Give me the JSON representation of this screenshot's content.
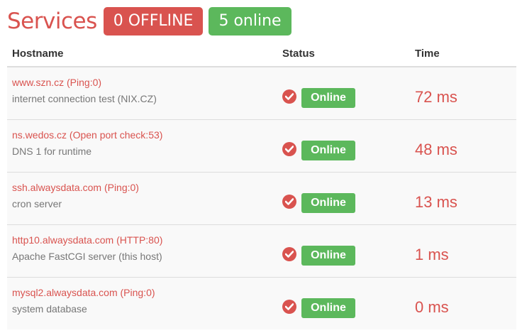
{
  "header": {
    "title": "Services",
    "offline_badge": "0 OFFLINE",
    "online_badge": "5 online"
  },
  "columns": {
    "hostname": "Hostname",
    "status": "Status",
    "time": "Time"
  },
  "colors": {
    "accent_red": "#d9534f",
    "success_green": "#5cb85c"
  },
  "rows": [
    {
      "host": "www.szn.cz (Ping:0)",
      "desc": "internet connection test (NIX.CZ)",
      "status": "Online",
      "time": "72 ms",
      "status_icon": "check-circle-icon"
    },
    {
      "host": "ns.wedos.cz (Open port check:53)",
      "desc": "DNS 1 for runtime",
      "status": "Online",
      "time": "48 ms",
      "status_icon": "check-circle-icon"
    },
    {
      "host": "ssh.alwaysdata.com (Ping:0)",
      "desc": "cron server",
      "status": "Online",
      "time": "13 ms",
      "status_icon": "check-circle-icon"
    },
    {
      "host": "http10.alwaysdata.com (HTTP:80)",
      "desc": "Apache FastCGI server (this host)",
      "status": "Online",
      "time": "1 ms",
      "status_icon": "check-circle-icon"
    },
    {
      "host": "mysql2.alwaysdata.com (Ping:0)",
      "desc": "system database",
      "status": "Online",
      "time": "0 ms",
      "status_icon": "check-circle-icon"
    }
  ]
}
